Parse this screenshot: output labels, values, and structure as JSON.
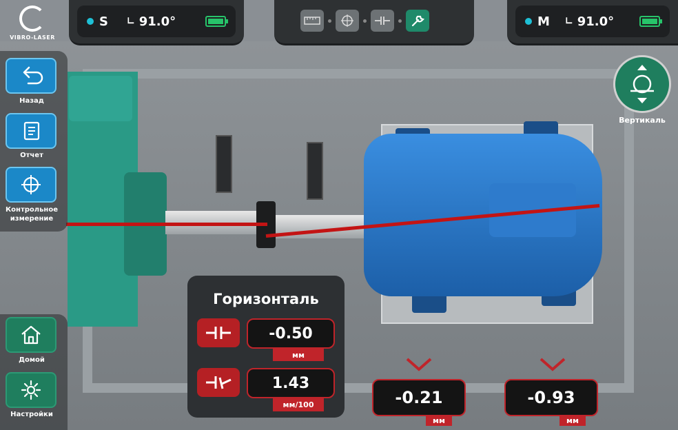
{
  "logo": {
    "text": "VIBRO-LASER"
  },
  "sensor_s": {
    "name": "S",
    "angle": "91.0°",
    "status_color": "#1ec0d6"
  },
  "sensor_m": {
    "name": "M",
    "angle": "91.0°",
    "status_color": "#1ec0d6"
  },
  "steps": [
    {
      "icon": "ruler-icon",
      "active": false
    },
    {
      "icon": "target-icon",
      "active": false
    },
    {
      "icon": "coupling-icon",
      "active": false
    },
    {
      "icon": "wrench-icon",
      "active": true
    }
  ],
  "sidebar": {
    "back_label": "Назад",
    "report_label": "Отчет",
    "check_label": "Контрольное измерение",
    "home_label": "Домой",
    "settings_label": "Настройки"
  },
  "view": {
    "vertical_label": "Вертикаль"
  },
  "panel": {
    "title": "Горизонталь",
    "offset": {
      "value": "-0.50",
      "unit": "мм"
    },
    "angularity": {
      "value": "1.43",
      "unit": "мм/100"
    }
  },
  "feet": [
    {
      "value": "-0.21",
      "unit": "мм"
    },
    {
      "value": "-0.93",
      "unit": "мм"
    }
  ],
  "colors": {
    "accent_green": "#1f7e5e",
    "accent_blue": "#1b88c8",
    "alert_red": "#c0242a",
    "laser_red": "#c31414"
  }
}
